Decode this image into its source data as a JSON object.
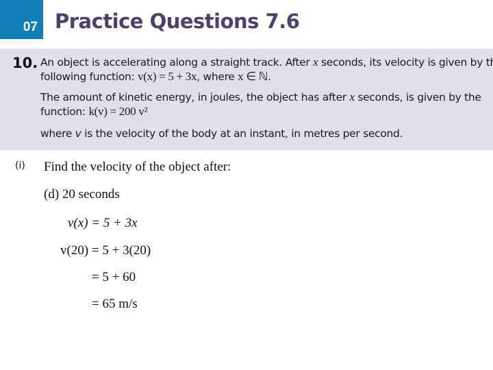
{
  "header": {
    "chapter_number": "07",
    "title": "Practice Questions 7.6",
    "accent_color": "#0f7fb5",
    "title_color": "#4f3f6b"
  },
  "question": {
    "number": "10.",
    "line1_a": "An object is accelerating along a straight track. After ",
    "line1_var": "x",
    "line1_b": " seconds, its velocity is given by the",
    "line2_a": "following function: ",
    "line2_math": "v(x) = 5 + 3x",
    "line2_b": ", where ",
    "line2_set": "x ∈ ℕ",
    "line2_c": ".",
    "line3_a": "The amount of kinetic energy, in joules, the object has after ",
    "line3_var": "x",
    "line3_b": " seconds, is given by the",
    "line4_a": "function:  ",
    "line4_math": "k(v) = 200 v²",
    "line5_a": "where ",
    "line5_var": "v",
    "line5_b": " is the velocity of the body at an instant, in metres per second.",
    "background_color": "#e3dfea"
  },
  "part": {
    "label": "(i)",
    "prompt": "Find the velocity of the object after:",
    "subpart": "(d)   20 seconds",
    "steps": [
      "v(x) = 5 + 3x",
      "v(20) = 5 + 3(20)",
      "= 5 + 60",
      "= 65 m/s"
    ]
  }
}
